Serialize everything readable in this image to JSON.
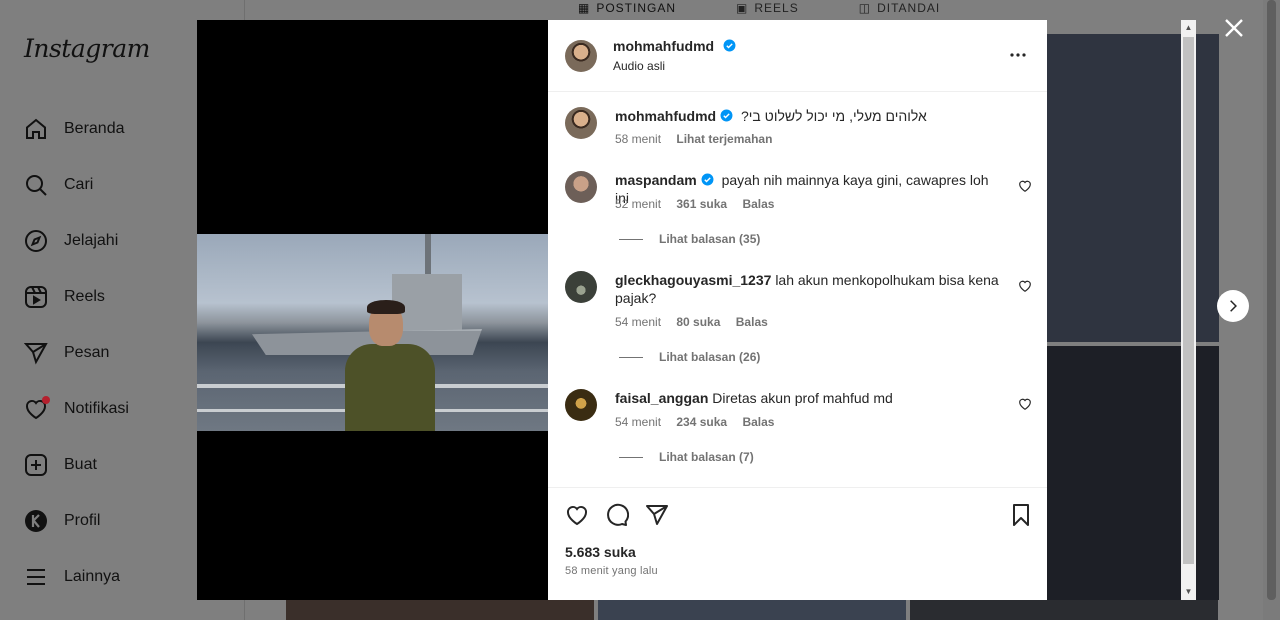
{
  "sidebar": {
    "logo": "Instagram",
    "items": [
      {
        "label": "Beranda",
        "icon": "home-icon"
      },
      {
        "label": "Cari",
        "icon": "search-icon"
      },
      {
        "label": "Jelajahi",
        "icon": "compass-icon"
      },
      {
        "label": "Reels",
        "icon": "reels-icon"
      },
      {
        "label": "Pesan",
        "icon": "send-icon"
      },
      {
        "label": "Notifikasi",
        "icon": "heart-icon"
      },
      {
        "label": "Buat",
        "icon": "plus-square-icon"
      },
      {
        "label": "Profil",
        "icon": "profile-avatar-icon"
      },
      {
        "label": "Lainnya",
        "icon": "menu-icon"
      }
    ]
  },
  "profile_tabs": {
    "posts": "POSTINGAN",
    "reels": "REELS",
    "tagged": "DITANDAI"
  },
  "post": {
    "header": {
      "username": "mohmahfudmd",
      "audio": "Audio asli"
    },
    "caption": {
      "username": "mohmahfudmd",
      "text": "אלוהים מעלי, מי יכול לשלוט בי?",
      "time": "58 menit",
      "translate": "Lihat terjemahan"
    },
    "comments": [
      {
        "username": "maspandam",
        "text": "payah nih mainnya kaya gini, cawapres loh ini",
        "time": "52 menit",
        "likes": "361 suka",
        "reply": "Balas",
        "view_replies": "Lihat balasan (35)"
      },
      {
        "username": "gleckhagouyasmi_1237",
        "text": "lah akun menkopolhukam bisa kena pajak?",
        "time": "54 menit",
        "likes": "80 suka",
        "reply": "Balas",
        "view_replies": "Lihat balasan (26)"
      },
      {
        "username": "faisal_anggan",
        "text": "Diretas akun prof mahfud md",
        "time": "54 menit",
        "likes": "234 suka",
        "reply": "Balas",
        "view_replies": "Lihat balasan (7)"
      }
    ],
    "likes": "5.683 suka",
    "time_ago": "58 menit yang lalu"
  },
  "colors": {
    "verified": "#0095f6",
    "notification_dot": "#b5202e",
    "overlay_bg": "#7f7f7f"
  }
}
